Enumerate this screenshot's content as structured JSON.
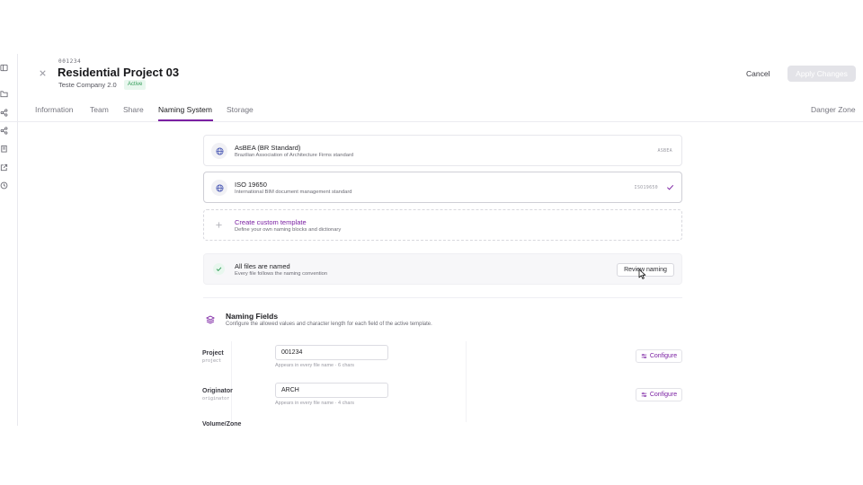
{
  "header": {
    "project_code": "001234",
    "project_title": "Residential Project 03",
    "company": "Teste Company 2.0",
    "status_badge": "Active",
    "cancel_label": "Cancel",
    "apply_label": "Apply Changes"
  },
  "tabs": [
    {
      "label": "Information",
      "active": false
    },
    {
      "label": "Team",
      "active": false
    },
    {
      "label": "Share",
      "active": false
    },
    {
      "label": "Naming System",
      "active": true
    },
    {
      "label": "Storage",
      "active": false
    }
  ],
  "danger_tab": "Danger Zone",
  "templates": [
    {
      "title": "AsBEA (BR Standard)",
      "description": "Brazilian Association of Architecture Firms standard",
      "code": "ASBEA",
      "selected": false,
      "icon": "globe-icon"
    },
    {
      "title": "ISO 19650",
      "description": "International BIM document management standard",
      "code": "ISO19650",
      "selected": true,
      "icon": "globe-icon"
    }
  ],
  "custom_template": {
    "title": "Create custom template",
    "description": "Define your own naming blocks and dictionary",
    "icon": "plus-icon"
  },
  "naming_status": {
    "title": "All files are named",
    "description": "Every file follows the naming convention",
    "button_label": "Review naming"
  },
  "naming_fields": {
    "title": "Naming Fields",
    "description": "Configure the allowed values and character length for each field of the active template.",
    "configure_label": "Configure",
    "fields": [
      {
        "label": "Project",
        "key": "project",
        "value": "001234",
        "hint": "Appears in every file name · 6 chars"
      },
      {
        "label": "Originator",
        "key": "originator",
        "value": "ARCH",
        "hint": "Appears in every file name · 4 chars"
      }
    ],
    "next_field_label": "Volume/Zone"
  },
  "colors": {
    "accent": "#7a1fa2",
    "success": "#2f9a56",
    "globe": "#4c5bb5"
  }
}
